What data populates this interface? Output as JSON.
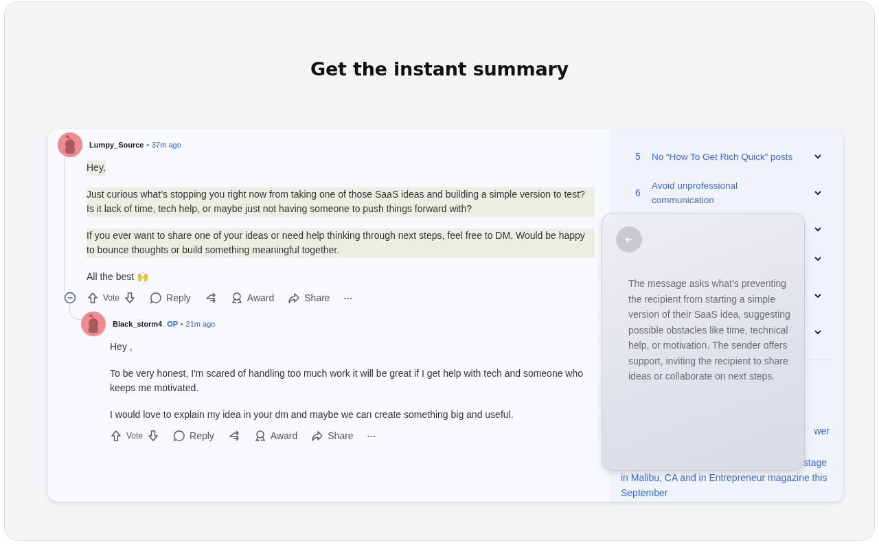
{
  "headline": "Get the instant summary",
  "comments": [
    {
      "author": "Lumpy_Source",
      "op": false,
      "separator": "•",
      "time": "37m ago",
      "collapsible": true,
      "paragraphs": [
        {
          "text": "Hey,",
          "highlighted": true
        },
        {
          "text": "Just curious what’s stopping you right now from taking one of those SaaS ideas and building a simple version to test? Is it lack of time, tech help, or maybe just not having someone to push things forward with?",
          "highlighted": true
        },
        {
          "text": "If you ever want to share one of your ideas or need help thinking through next steps, feel free to DM. Would be happy to bounce thoughts or build something meaningful together.",
          "highlighted": true
        },
        {
          "text": "All the best 🙌",
          "highlighted": false
        }
      ],
      "actions": [
        {
          "kind": "vote",
          "label": "Vote"
        },
        {
          "kind": "reply",
          "label": "Reply"
        },
        {
          "kind": "crosspost"
        },
        {
          "kind": "award",
          "label": "Award"
        },
        {
          "kind": "share",
          "label": "Share"
        },
        {
          "kind": "more",
          "label": "···"
        }
      ]
    },
    {
      "author": "Black_storm4",
      "op": true,
      "op_label": "OP",
      "separator": "•",
      "time": "21m ago",
      "collapsible": false,
      "paragraphs": [
        {
          "text": "Hey ,",
          "highlighted": false
        },
        {
          "text": "To be very honest, I'm scared of handling too much work it will be great if I get help with tech and someone who keeps me motivated.",
          "highlighted": false
        },
        {
          "text": "I would love to explain my idea in your dm and maybe we can create something big and useful.",
          "highlighted": false
        }
      ],
      "actions": [
        {
          "kind": "vote",
          "label": "Vote"
        },
        {
          "kind": "reply",
          "label": "Reply"
        },
        {
          "kind": "crosspost"
        },
        {
          "kind": "award",
          "label": "Award"
        },
        {
          "kind": "share",
          "label": "Share"
        },
        {
          "kind": "more",
          "label": "···"
        }
      ]
    }
  ],
  "sidebar": {
    "rules": [
      {
        "number": "5",
        "title": "No “How To Get Rich Quick” posts",
        "expanded": false
      },
      {
        "number": "6",
        "title": "Avoid unprofessional communication",
        "expanded": false
      },
      {
        "expanded": false
      },
      {
        "expanded": false
      },
      {
        "expanded": false
      },
      {
        "expanded": false
      }
    ],
    "text_fragments": [
      "wer",
      "stage",
      "in Malibu, CA and in Entrepreneur magazine this",
      "September"
    ]
  },
  "summary": {
    "text": "The message asks what’s preventing the recipient from starting a simple version of their SaaS idea, suggesting possible obstacles like time, technical help, or motivation. The sender offers support, inviting the recipient to share ideas or collaborate on next steps."
  }
}
